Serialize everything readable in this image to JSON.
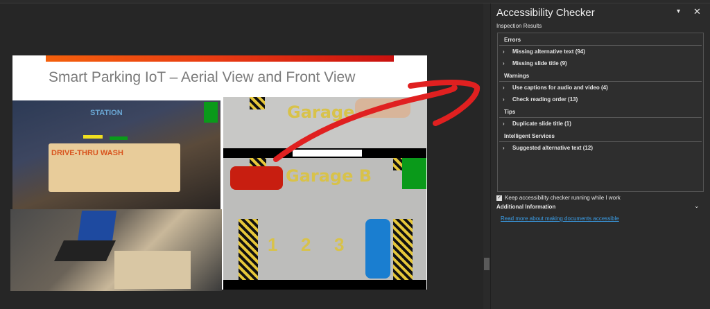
{
  "slide": {
    "title": "Smart Parking IoT – Aerial View and Front View",
    "photo_text": {
      "station": "STATION",
      "wash": "DRIVE-THRU WASH",
      "garage_top": "Garage",
      "garage_b": "Garage B",
      "spots": [
        "1",
        "2",
        "3"
      ]
    }
  },
  "panel": {
    "title": "Accessibility Checker",
    "subtitle": "Inspection Results",
    "sections": [
      {
        "label": "Errors",
        "items": [
          "Missing alternative text (94)",
          "Missing slide title (9)"
        ]
      },
      {
        "label": "Warnings",
        "items": [
          "Use captions for audio and video (4)",
          "Check reading order (13)"
        ]
      },
      {
        "label": "Tips",
        "items": [
          "Duplicate slide title (1)"
        ]
      },
      {
        "label": "Intelligent Services",
        "items": [
          "Suggested alternative text (12)"
        ]
      }
    ],
    "keep_running": {
      "label": "Keep accessibility checker running while I work",
      "checked": true
    },
    "additional_info": "Additional Information",
    "link": "Read more about making documents accessible"
  },
  "colors": {
    "ink": "#e02020",
    "link": "#3a9ee8",
    "accent": "#e83a12"
  }
}
